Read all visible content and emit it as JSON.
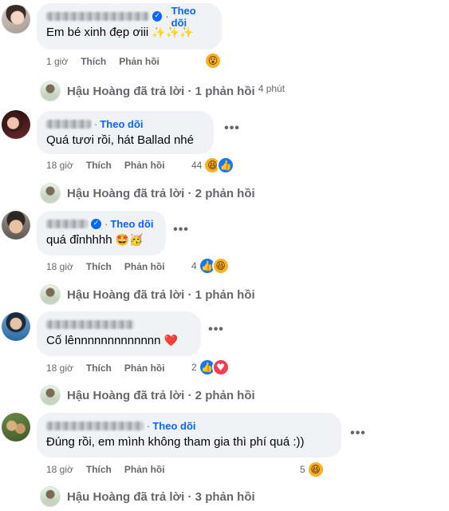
{
  "common": {
    "follow": "Theo dõi",
    "like": "Thích",
    "reply": "Phản hồi",
    "dot": "·",
    "more": "•••",
    "replier": "Hậu Hoàng"
  },
  "comments": [
    {
      "text": "Em bé xinh đẹp ơiii",
      "text_emoji": "✨✨✨",
      "time": "1 giờ",
      "reaction_count": "",
      "reactions": [
        "wow-icon"
      ],
      "replies_label": "Hậu Hoàng đã trả lời · 1 phản hồi",
      "replies_time": "4 phút"
    },
    {
      "text": "Quá tươi rồi, hát Ballad nhé",
      "text_emoji": "",
      "time": "18 giờ",
      "reaction_count": "44",
      "reactions": [
        "haha-icon",
        "like-icon"
      ],
      "replies_label": "Hậu Hoàng đã trả lời · 2 phản hồi",
      "replies_time": ""
    },
    {
      "text": "quá đỉnhhhh",
      "text_emoji": "🤩🥳",
      "time": "18 giờ",
      "reaction_count": "4",
      "reactions": [
        "like-icon",
        "haha-icon"
      ],
      "replies_label": "Hậu Hoàng đã trả lời · 1 phản hồi",
      "replies_time": ""
    },
    {
      "text": "Cố lênnnnnnnnnnnnn",
      "text_emoji": "❤️",
      "time": "18 giờ",
      "reaction_count": "2",
      "reactions": [
        "like-icon",
        "love-icon"
      ],
      "replies_label": "Hậu Hoàng đã trả lời · 2 phản hồi",
      "replies_time": ""
    },
    {
      "text": "Đúng rồi, em mình không tham gia thì phí quá :))",
      "text_emoji": "",
      "time": "18 giờ",
      "reaction_count": "5",
      "reactions": [
        "haha-icon"
      ],
      "replies_label": "Hậu Hoàng đã trả lời · 3 phản hồi",
      "replies_time": ""
    }
  ]
}
